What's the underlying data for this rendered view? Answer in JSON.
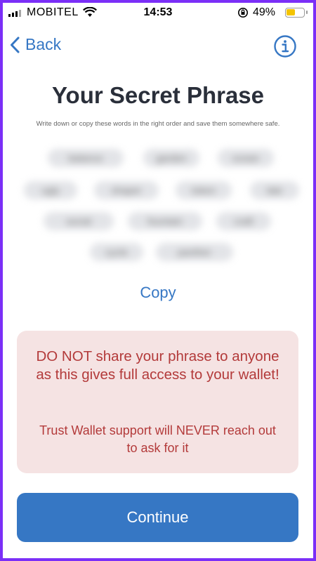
{
  "status_bar": {
    "carrier": "MOBITEL",
    "time": "14:53",
    "battery_percent": "49%",
    "battery_level": 0.49
  },
  "nav": {
    "back_label": "Back",
    "info_icon": "info-circle-icon"
  },
  "title": "Your Secret Phrase",
  "subtitle": "Write down or copy these words in the right order and save them somewhere safe.",
  "phrase_words": [
    {
      "text": "balance"
    },
    {
      "text": "garden"
    },
    {
      "text": "ocean"
    },
    {
      "text": "ugly"
    },
    {
      "text": "shaper"
    },
    {
      "text": "token"
    },
    {
      "text": "late"
    },
    {
      "text": "social"
    },
    {
      "text": "fountain"
    },
    {
      "text": "craft"
    },
    {
      "text": "cycle"
    },
    {
      "text": "panther"
    }
  ],
  "copy_label": "Copy",
  "warning": {
    "main": "DO NOT share your phrase to anyone as this gives full access to your wallet!",
    "secondary": "Trust Wallet support will NEVER reach out to ask for it"
  },
  "continue_label": "Continue",
  "colors": {
    "accent": "#3677c4",
    "warning_bg": "#f5e3e3",
    "warning_text": "#b33a3a",
    "frame": "#7b2ff7"
  }
}
